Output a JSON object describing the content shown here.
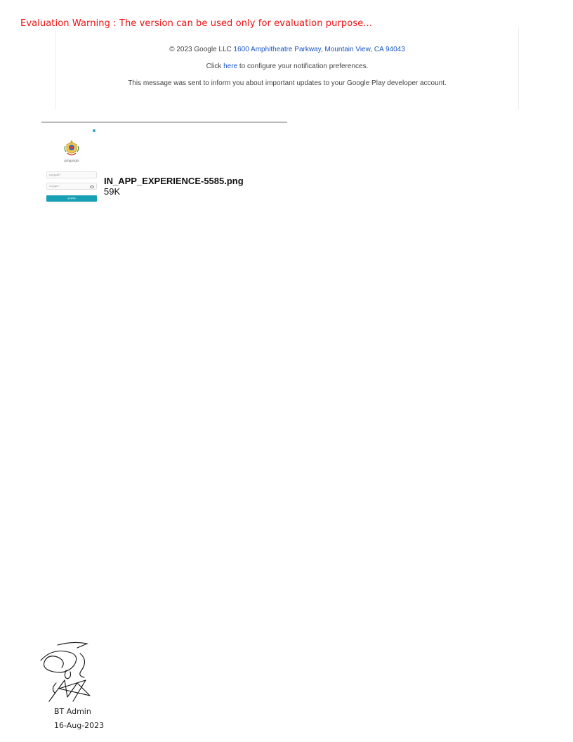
{
  "watermark": {
    "text": "Evaluation Warning : The version can be used only for evaluation purpose...",
    "color": "#ee1111"
  },
  "email_footer": {
    "copyright": "© 2023 Google LLC",
    "address": "1600 Amphitheatre Parkway, Mountain View, CA 94043",
    "prefs_before": "Click",
    "prefs_link": "here",
    "prefs_after": "to configure your notification preferences.",
    "notice": "This message was sent to inform you about important updates to your Google Play developer account.",
    "link_color": "#1a56c4"
  },
  "attachment": {
    "filename": "IN_APP_EXPERIENCE-5585.png",
    "size": "59K",
    "thumbnail": {
      "app_label": "ប្រព័ន្ធគ្រប់គ្រង",
      "username_placeholder": "ឈ្មោះអ្នកប្រើ *",
      "password_placeholder": "ពាក្យសម្ងាត់ *",
      "login_button": "ចូលប្រព័ន្ធ",
      "accent_color": "#17a0b5"
    }
  },
  "signature_block": {
    "name": "BT Admin",
    "date": "16-Aug-2023"
  }
}
